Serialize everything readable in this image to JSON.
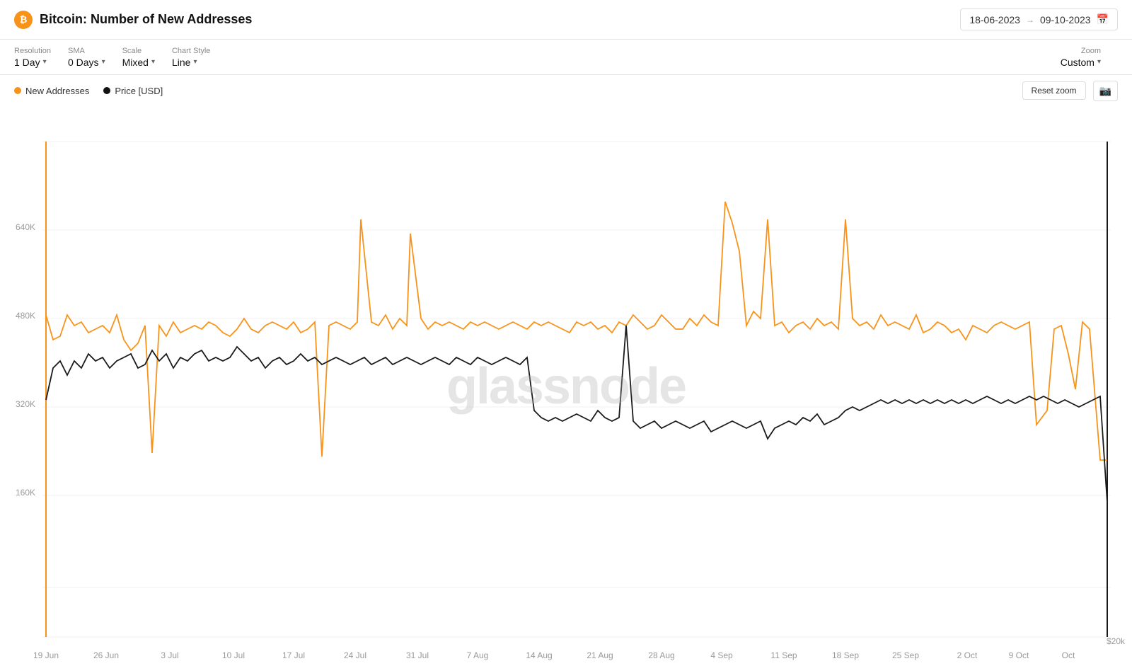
{
  "header": {
    "title": "Bitcoin: Number of New Addresses",
    "btc_symbol": "₿",
    "date_start": "18-06-2023",
    "date_end": "09-10-2023"
  },
  "controls": {
    "resolution_label": "Resolution",
    "resolution_value": "1 Day",
    "sma_label": "SMA",
    "sma_value": "0 Days",
    "scale_label": "Scale",
    "scale_value": "Mixed",
    "chart_style_label": "Chart Style",
    "chart_style_value": "Line",
    "zoom_label": "Zoom",
    "zoom_value": "Custom"
  },
  "legend": {
    "new_addresses_label": "New Addresses",
    "price_label": "Price [USD]",
    "reset_zoom": "Reset zoom"
  },
  "chart": {
    "y_labels": [
      "160K",
      "320K",
      "480K",
      "640K",
      ""
    ],
    "x_labels": [
      "19 Jun",
      "26 Jun",
      "3 Jul",
      "10 Jul",
      "17 Jul",
      "24 Jul",
      "31 Jul",
      "7 Aug",
      "14 Aug",
      "21 Aug",
      "28 Aug",
      "4 Sep",
      "11 Sep",
      "18 Sep",
      "25 Sep",
      "2 Oct",
      "9 Oct"
    ],
    "y_right_label": "$20k",
    "watermark": "glassnode",
    "colors": {
      "orange": "#F7931A",
      "black": "#1a1a1a",
      "grid": "#f0f0f0",
      "accent": "#F7931A"
    }
  }
}
